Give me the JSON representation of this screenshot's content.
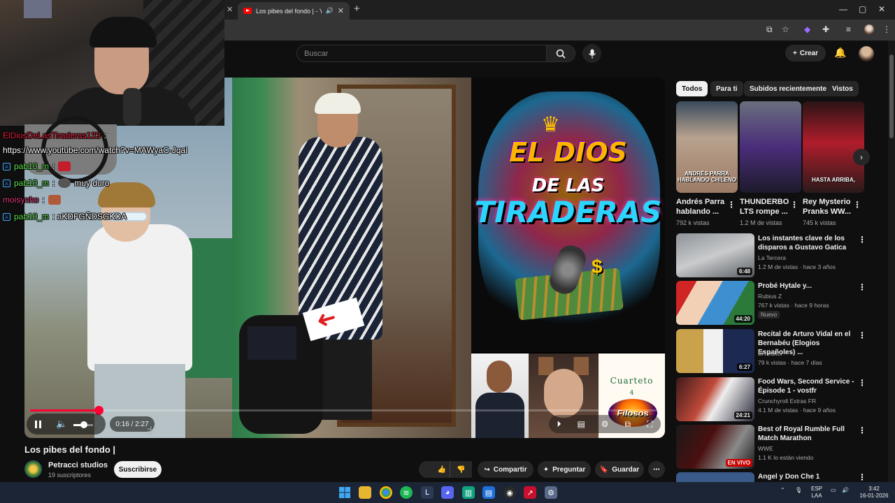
{
  "browser": {
    "tab_title": "Los pibes del fondo | - YouTube",
    "new_tab_icon": "+",
    "window_controls": [
      "—",
      "▢",
      "✕"
    ],
    "toolbar_icons": [
      "cast-icon",
      "star-icon",
      "extension-icon",
      "puzzle-icon",
      "media-icon",
      "profile-icon",
      "more-icon"
    ]
  },
  "header": {
    "search_placeholder": "Buscar",
    "create_label": "Crear"
  },
  "chat": {
    "messages": [
      {
        "user": "ElDiosDeLasTiraderas123",
        "text": ":"
      },
      {
        "user": "",
        "text": "https://www.youtube.com/watch?v=MAWyaC-Jqal"
      },
      {
        "user": "pab10_m",
        "text": ":"
      },
      {
        "user": "pab10_m",
        "text": ":",
        "emote_text": "muy duro"
      },
      {
        "user": "moisynho",
        "text": ":"
      },
      {
        "user": "pab10_m",
        "text": ": aKDFGÑDSGKDA"
      }
    ],
    "colors": {
      "red": "#e0233b",
      "green": "#5fe14d",
      "pink": "#e03c7d"
    }
  },
  "player": {
    "thumbnail_lines": [
      "EL DIOS",
      "DE LAS",
      "TIRADERAS"
    ],
    "panel6_title": "Cuarteto",
    "panel6_number": "4",
    "panel6_logo": "Filosos",
    "time": "0:16 / 2:27",
    "progress_fraction": 0.109,
    "volume_fraction": 0.55,
    "accent": "#ff0033"
  },
  "video": {
    "title": "Los pibes del fondo |",
    "channel": "Petracci studios",
    "subscribers": "19 suscriptores",
    "subscribe_label": "Suscribirse",
    "likes": "2",
    "share_label": "Compartir",
    "ask_label": "Preguntar",
    "save_label": "Guardar"
  },
  "chips": [
    "Todos",
    "Para ti",
    "Subidos recientemente",
    "Vistos"
  ],
  "shorts": [
    {
      "title": "Andrés Parra hablando ...",
      "views": "792 k vistas",
      "caption": "ANDRÉS PARRA HABLANDO CHILENO"
    },
    {
      "title": "THUNDERBO LTS rompe ...",
      "views": "1.2 M de vistas",
      "caption": ""
    },
    {
      "title": "Rey Mysterio Pranks WW...",
      "views": "745 k vistas",
      "caption": "HASTA ARRIBA,"
    }
  ],
  "recommended": [
    {
      "title": "Los instantes clave de los disparos a Gustavo Gatica",
      "channel": "La Tercera",
      "meta": "1.2 M de vistas · hace 3 años",
      "duration": "6:48"
    },
    {
      "title": "Probé Hytale y...",
      "channel": "Rubius Z",
      "meta": "767 k vistas · hace 9 horas",
      "duration": "44:20",
      "badge": "Nuevo"
    },
    {
      "title": "Recital de Arturo Vidal en el Bernabéu (Elogios Españoles) ...",
      "channel": "BR editor",
      "meta": "79 k vistas · hace 7 días",
      "duration": "6:27"
    },
    {
      "title": "Food Wars, Second Service - Épisode 1 - vostfr",
      "channel": "Crunchyroll Extras FR",
      "meta": "4.1 M de vistas · hace 9 años",
      "duration": "24:21"
    },
    {
      "title": "Best of Royal Rumble Full Match Marathon",
      "channel": "WWE",
      "meta": "1.1 K lo están viendo",
      "live": "EN VIVO"
    },
    {
      "title": "Angel y Don Che 1",
      "channel": "",
      "meta": ""
    }
  ],
  "taskbar": {
    "lang_top": "ESP",
    "lang_bottom": "LAA",
    "time": "3:42",
    "date": "16-01-2026"
  }
}
